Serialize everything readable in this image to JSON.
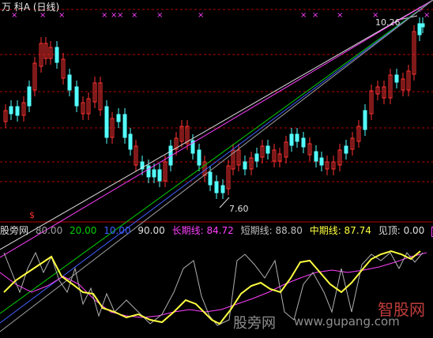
{
  "title": "万 科A (日线)",
  "main": {
    "high_label": "10.26",
    "low_label": "7.60",
    "signal_mark": "$"
  },
  "indicator": {
    "name": "股旁网",
    "levels": [
      {
        "label": "80.00",
        "color": "#a0a0a0"
      },
      {
        "label": "20.00",
        "color": "#00d000"
      },
      {
        "label": "10.00",
        "color": "#4060ff"
      },
      {
        "label": "90.00",
        "color": "#e0e0e0"
      }
    ],
    "long_label": "长期线: 84.72",
    "short_label": "短期线: 88.80",
    "mid_label": "中期线: 87.74",
    "top_label": "见顶: 0.00",
    "top_mark": "顶底"
  },
  "watermark": {
    "left": "股旁网",
    "right": "www.gupang.com",
    "logo": "智股网"
  },
  "colors": {
    "up": "#ff3232",
    "down": "#54ffff",
    "grid": "#b40000",
    "yellow": "#ffff40",
    "magenta": "#ff40ff"
  }
}
